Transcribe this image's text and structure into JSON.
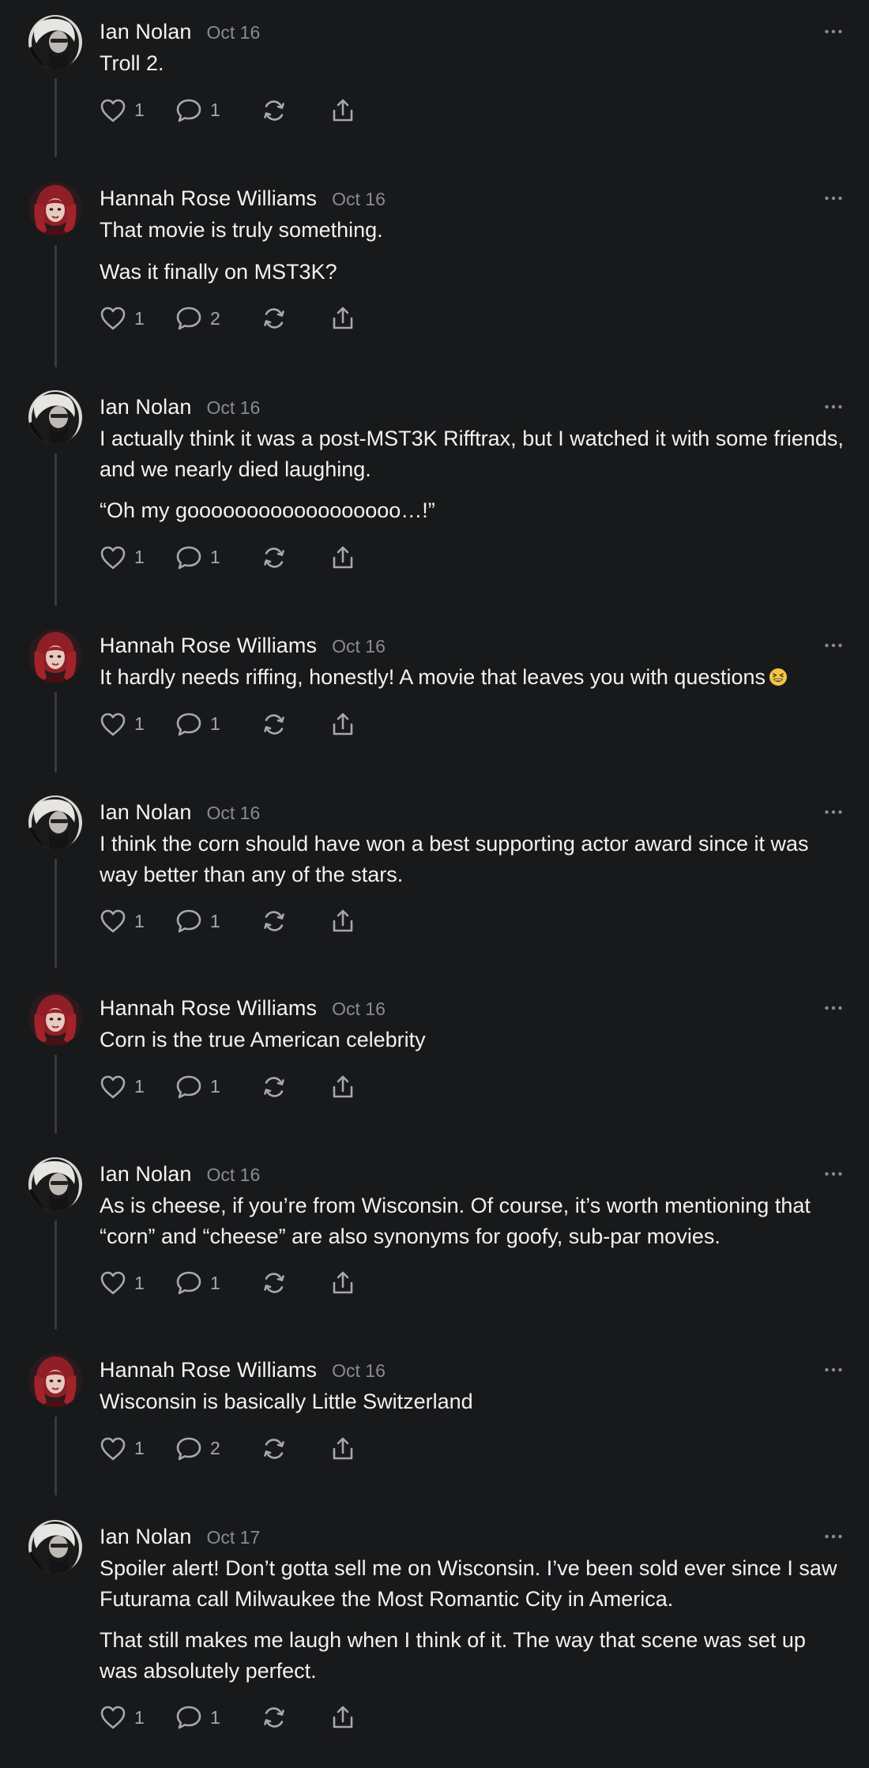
{
  "posts": [
    {
      "author": "Ian Nolan",
      "date": "Oct 16",
      "avatar": "ian-avatar",
      "paragraphs": [
        "Troll 2."
      ],
      "likes": "1",
      "replies": "1"
    },
    {
      "author": "Hannah Rose Williams",
      "date": "Oct 16",
      "avatar": "hannah-avatar",
      "paragraphs": [
        "That movie is truly something.",
        "Was it finally on MST3K?"
      ],
      "likes": "1",
      "replies": "2"
    },
    {
      "author": "Ian Nolan",
      "date": "Oct 16",
      "avatar": "ian-avatar",
      "paragraphs": [
        "I actually think it was a post-MST3K Rifftrax, but I watched it with some friends, and we nearly died laughing.",
        "“Oh my goooooooooooooooooo…!”"
      ],
      "likes": "1",
      "replies": "1"
    },
    {
      "author": "Hannah Rose Williams",
      "date": "Oct 16",
      "avatar": "hannah-avatar",
      "paragraphs": [
        "It hardly needs riffing, honestly! A movie that leaves you with questions"
      ],
      "emoji_after": "grinning-squinting-face-emoji",
      "likes": "1",
      "replies": "1"
    },
    {
      "author": "Ian Nolan",
      "date": "Oct 16",
      "avatar": "ian-avatar",
      "paragraphs": [
        "I think the corn should have won a best supporting actor award since it was way better than any of the stars."
      ],
      "likes": "1",
      "replies": "1"
    },
    {
      "author": "Hannah Rose Williams",
      "date": "Oct 16",
      "avatar": "hannah-avatar",
      "paragraphs": [
        "Corn is the true American celebrity"
      ],
      "likes": "1",
      "replies": "1"
    },
    {
      "author": "Ian Nolan",
      "date": "Oct 16",
      "avatar": "ian-avatar",
      "paragraphs": [
        "As is cheese, if you’re from Wisconsin. Of course, it’s worth mentioning that “corn” and “cheese” are also synonyms for goofy, sub-par movies."
      ],
      "likes": "1",
      "replies": "1"
    },
    {
      "author": "Hannah Rose Williams",
      "date": "Oct 16",
      "avatar": "hannah-avatar",
      "paragraphs": [
        "Wisconsin is basically Little Switzerland"
      ],
      "likes": "1",
      "replies": "2"
    },
    {
      "author": "Ian Nolan",
      "date": "Oct 17",
      "avatar": "ian-avatar",
      "paragraphs": [
        "Spoiler alert! Don’t gotta sell me on Wisconsin. I’ve been sold ever since I saw Futurama call Milwaukee the Most Romantic City in America.",
        "That still makes me laugh when I think of it. The way that scene was set up was absolutely perfect."
      ],
      "likes": "1",
      "replies": "1"
    }
  ],
  "icons": {
    "like": "heart-icon",
    "reply": "speech-bubble-icon",
    "repost": "repost-icon",
    "share": "share-icon",
    "more": "more-options-icon"
  },
  "colors": {
    "background": "#18191b",
    "text": "#f2f2f2",
    "muted": "#8a8b8f",
    "icon": "#a7a8ab",
    "thread_line": "#3a3b3e"
  }
}
